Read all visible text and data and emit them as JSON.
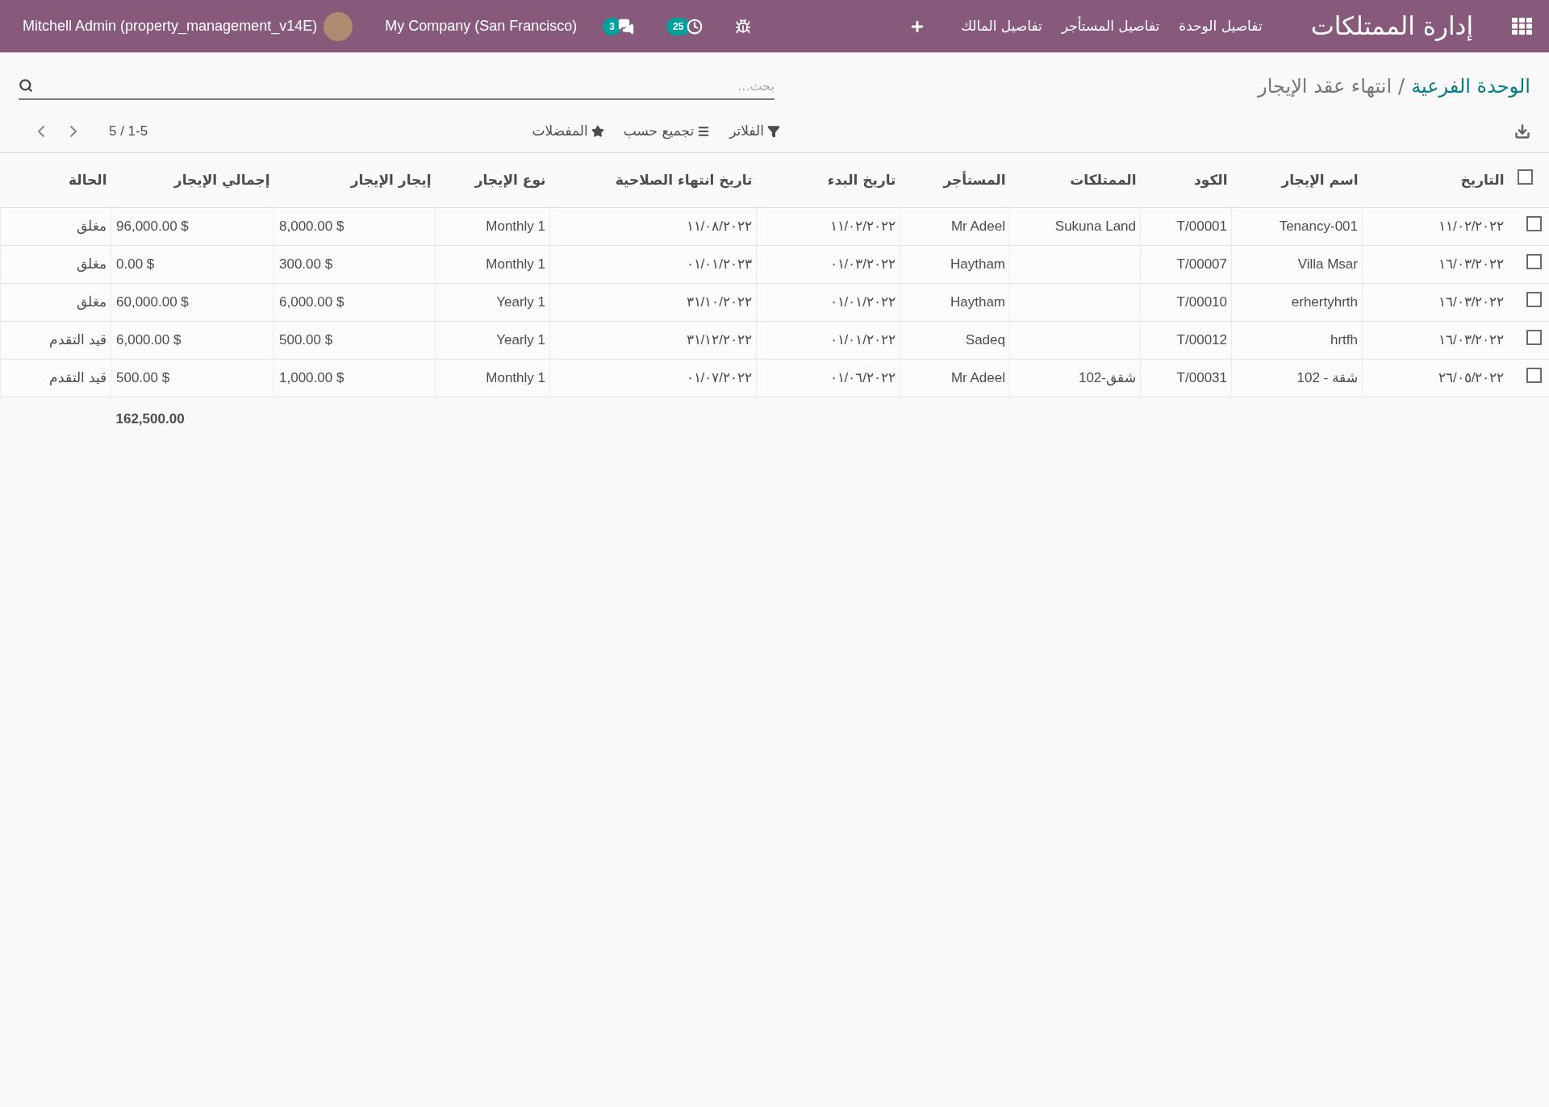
{
  "navbar": {
    "app_title": "إدارة الممتلكات",
    "menu_items": [
      "تفاصيل الوحدة",
      "تفاصيل المستأجر",
      "تفاصيل المالك"
    ],
    "messages_count": "3",
    "activities_count": "25",
    "company": "My Company (San Francisco)",
    "user": "Mitchell Admin (property_management_v14E)"
  },
  "breadcrumb": [
    {
      "label": "الوحدة الفرعية",
      "kind": "link"
    },
    {
      "label": "/",
      "kind": "separator"
    },
    {
      "label": "انتهاء عقد الإيجار",
      "kind": "current"
    }
  ],
  "search": {
    "placeholder": "بحث..."
  },
  "toolbar": {
    "filters": "الفلاتر",
    "group_by": "تجميع حسب",
    "favorites": "المفضلات",
    "pager": "5 / 1-5"
  },
  "table": {
    "select_all": {
      "checked": false
    },
    "columns": [
      {
        "label": "التاريخ",
        "kind": "text"
      },
      {
        "label": "اسم الإيجار",
        "kind": "text"
      },
      {
        "label": "الكود",
        "kind": "text"
      },
      {
        "label": "الممتلكات",
        "kind": "text"
      },
      {
        "label": "المستأجر",
        "kind": "text"
      },
      {
        "label": "تاريخ البدء",
        "kind": "text"
      },
      {
        "label": "تاريخ انتهاء الصلاحية",
        "kind": "text"
      },
      {
        "label": "نوع الإيجار",
        "kind": "text"
      },
      {
        "label": "إيجار الإيجار",
        "kind": "money"
      },
      {
        "label": "إجمالي الإيجار",
        "kind": "money",
        "total": "162,500.00"
      },
      {
        "label": "الحالة",
        "kind": "text"
      }
    ],
    "rows": [
      {
        "checked": false,
        "cells": [
          "١١/٠٢/٢٠٢٢",
          "Tenancy-001",
          "T/00001",
          "Sukuna Land",
          "Mr Adeel",
          "١١/٠٢/٢٠٢٢",
          "١١/٠٨/٢٠٢٢",
          "Monthly 1",
          "8,000.00 $",
          "96,000.00 $",
          "مغلق"
        ]
      },
      {
        "checked": false,
        "cells": [
          "١٦/٠٣/٢٠٢٢",
          "Villa Msar",
          "T/00007",
          "",
          "Haytham",
          "٠١/٠٣/٢٠٢٢",
          "٠١/٠١/٢٠٢٣",
          "Monthly 1",
          "300.00 $",
          "0.00 $",
          "مغلق"
        ]
      },
      {
        "checked": false,
        "cells": [
          "١٦/٠٣/٢٠٢٢",
          "erhertyhrth",
          "T/00010",
          "",
          "Haytham",
          "٠١/٠١/٢٠٢٢",
          "٣١/١٠/٢٠٢٢",
          "Yearly 1",
          "6,000.00 $",
          "60,000.00 $",
          "مغلق"
        ]
      },
      {
        "checked": false,
        "cells": [
          "١٦/٠٣/٢٠٢٢",
          "hrtfh",
          "T/00012",
          "",
          "Sadeq",
          "٠١/٠١/٢٠٢٢",
          "٣١/١٢/٢٠٢٢",
          "Yearly 1",
          "500.00 $",
          "6,000.00 $",
          "قيد التقدم"
        ]
      },
      {
        "checked": false,
        "cells": [
          "٢٦/٠٥/٢٠٢٢",
          "شقة - 102",
          "T/00031",
          "شقق-102",
          "Mr Adeel",
          "٠١/٠٦/٢٠٢٢",
          "٠١/٠٧/٢٠٢٢",
          "Monthly 1",
          "1,000.00 $",
          "500.00 $",
          "قيد التقدم"
        ]
      }
    ]
  }
}
